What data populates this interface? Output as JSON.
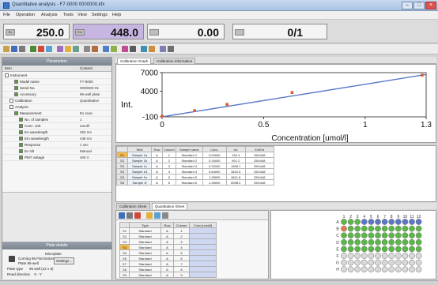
{
  "window": {
    "title": "Quantitative analysis - F7-0000 0000000.kfx"
  },
  "menu": [
    "File",
    "Operation",
    "Analysis",
    "Tools",
    "View",
    "Settings",
    "Help"
  ],
  "readouts": [
    {
      "label": "Ex",
      "value": "250.0"
    },
    {
      "label": "Em",
      "value": "448.0"
    },
    {
      "label": "",
      "value": "0.00"
    },
    {
      "label": "",
      "value": "0/1"
    }
  ],
  "left": {
    "header": "Parameters",
    "tree_headers": [
      "Item",
      "Content"
    ],
    "tree": [
      {
        "key": "Instrument",
        "value": "",
        "indent": 0
      },
      {
        "key": "Model name",
        "value": "F7-8000",
        "indent": 2
      },
      {
        "key": "Serial No.",
        "value": "0000000-01",
        "indent": 2
      },
      {
        "key": "Accessory",
        "value": "96-well plate",
        "indent": 2
      },
      {
        "key": "Calibration",
        "value": "Quantitative",
        "indent": 1
      },
      {
        "key": "Analysis",
        "value": "",
        "indent": 1
      },
      {
        "key": "Measurement",
        "value": "Ex scan",
        "indent": 2
      },
      {
        "key": "No. of samples",
        "value": "1",
        "indent": 3
      },
      {
        "key": "Conc. unit",
        "value": "umol/l",
        "indent": 3
      },
      {
        "key": "Ex wavelength",
        "value": "250 nm",
        "indent": 3
      },
      {
        "key": "Em wavelength",
        "value": "448 nm",
        "indent": 3
      },
      {
        "key": "Response",
        "value": "1 sec",
        "indent": 3
      },
      {
        "key": "Ex slit",
        "value": "Manual",
        "indent": 3
      },
      {
        "key": "PMT voltage",
        "value": "400 V",
        "indent": 3
      }
    ],
    "plate_header": "Plate details",
    "plate_sub": "Microplate",
    "plate_title": "Corning 96 Flat Bottom",
    "plate_name": "Plate 96-well",
    "plate_type_label": "Plate type",
    "plate_type": "96 well (12 x 8)",
    "read_direction_label": "Read direction",
    "read_direction": "X - Y",
    "settings_button": "Settings..."
  },
  "graph": {
    "tabs": [
      "Calibration Graph",
      "Calibration Information"
    ],
    "active_tab": 0,
    "ylabel": "Int.",
    "xlabel": "Concentration [umol/l]",
    "y_ticks": [
      "7000",
      "4000",
      "-100"
    ],
    "x_ticks": [
      "0",
      "0.5",
      "1",
      "1.3"
    ]
  },
  "chart_data": {
    "type": "scatter",
    "x": [
      0,
      0.16,
      0.32,
      0.64,
      1.28
    ],
    "y": [
      0,
      900,
      1900,
      3800,
      6600
    ],
    "fit_line": {
      "x": [
        0,
        1.3
      ],
      "y": [
        -100,
        6700
      ]
    },
    "xlim": [
      0,
      1.3
    ],
    "ylim": [
      -100,
      7000
    ],
    "xlabel": "Concentration [umol/l]",
    "ylabel": "Int.",
    "grid": false,
    "point_color": "#e05a2b",
    "line_color": "#5a79c8"
  },
  "sample_table": {
    "headers": [
      "",
      "Well",
      "Row",
      "Column",
      "Sample name",
      "Conc.",
      "Int.",
      "Ex/Em"
    ],
    "rows": [
      [
        "S1",
        "Sample 1a",
        "A",
        "1",
        "Standard 1",
        "0.00000",
        "152.4",
        "250/448"
      ],
      [
        "S2",
        "Sample 1b",
        "A",
        "2",
        "Standard 2",
        "0.16000",
        "901.2",
        "250/448"
      ],
      [
        "S3",
        "Sample 1c",
        "A",
        "3",
        "Standard 3",
        "0.32000",
        "1895.1",
        "250/448"
      ],
      [
        "S4",
        "Sample 1d",
        "A",
        "4",
        "Standard 4",
        "0.64000",
        "3812.6",
        "250/448"
      ],
      [
        "S5",
        "Sample 1e",
        "A",
        "5",
        "Standard 5",
        "1.28000",
        "6611.8",
        "250/448"
      ],
      [
        "S6",
        "Sample 1f",
        "A",
        "6",
        "Standard 6",
        "1.28000",
        "6598.0",
        "250/448"
      ]
    ]
  },
  "bottom_tabs": [
    "Calibration Sheet",
    "Quantitation Sheet"
  ],
  "sequence": {
    "headers": [
      "",
      "Type",
      "Row",
      "Column",
      "Conc.[umol/l]"
    ],
    "rows": [
      [
        "S1",
        "Standard",
        "A",
        "1",
        ""
      ],
      [
        "S2",
        "Standard",
        "A",
        "2",
        ""
      ],
      [
        "S3",
        "Standard",
        "A",
        "3",
        ""
      ],
      [
        "S4",
        "Standard",
        "A",
        "4",
        ""
      ],
      [
        "S5",
        "Standard",
        "A",
        "5",
        ""
      ],
      [
        "S6",
        "Standard",
        "A",
        "6",
        ""
      ],
      [
        "S7",
        "Standard",
        "A",
        "7",
        ""
      ],
      [
        "S8",
        "Standard",
        "A",
        "8",
        ""
      ],
      [
        "S9",
        "Standard",
        "A",
        "9",
        ""
      ]
    ]
  },
  "plate": {
    "rows": [
      "A",
      "B",
      "C",
      "D",
      "E",
      "F",
      "G",
      "H"
    ],
    "cols": [
      "1",
      "2",
      "3",
      "4",
      "5",
      "6",
      "7",
      "8",
      "9",
      "10",
      "11",
      "12"
    ],
    "colors": {
      "standard": "#5bb848",
      "selected": "#e27a4e",
      "blank": "#5b76c5",
      "empty": "#d9d9d9"
    }
  }
}
